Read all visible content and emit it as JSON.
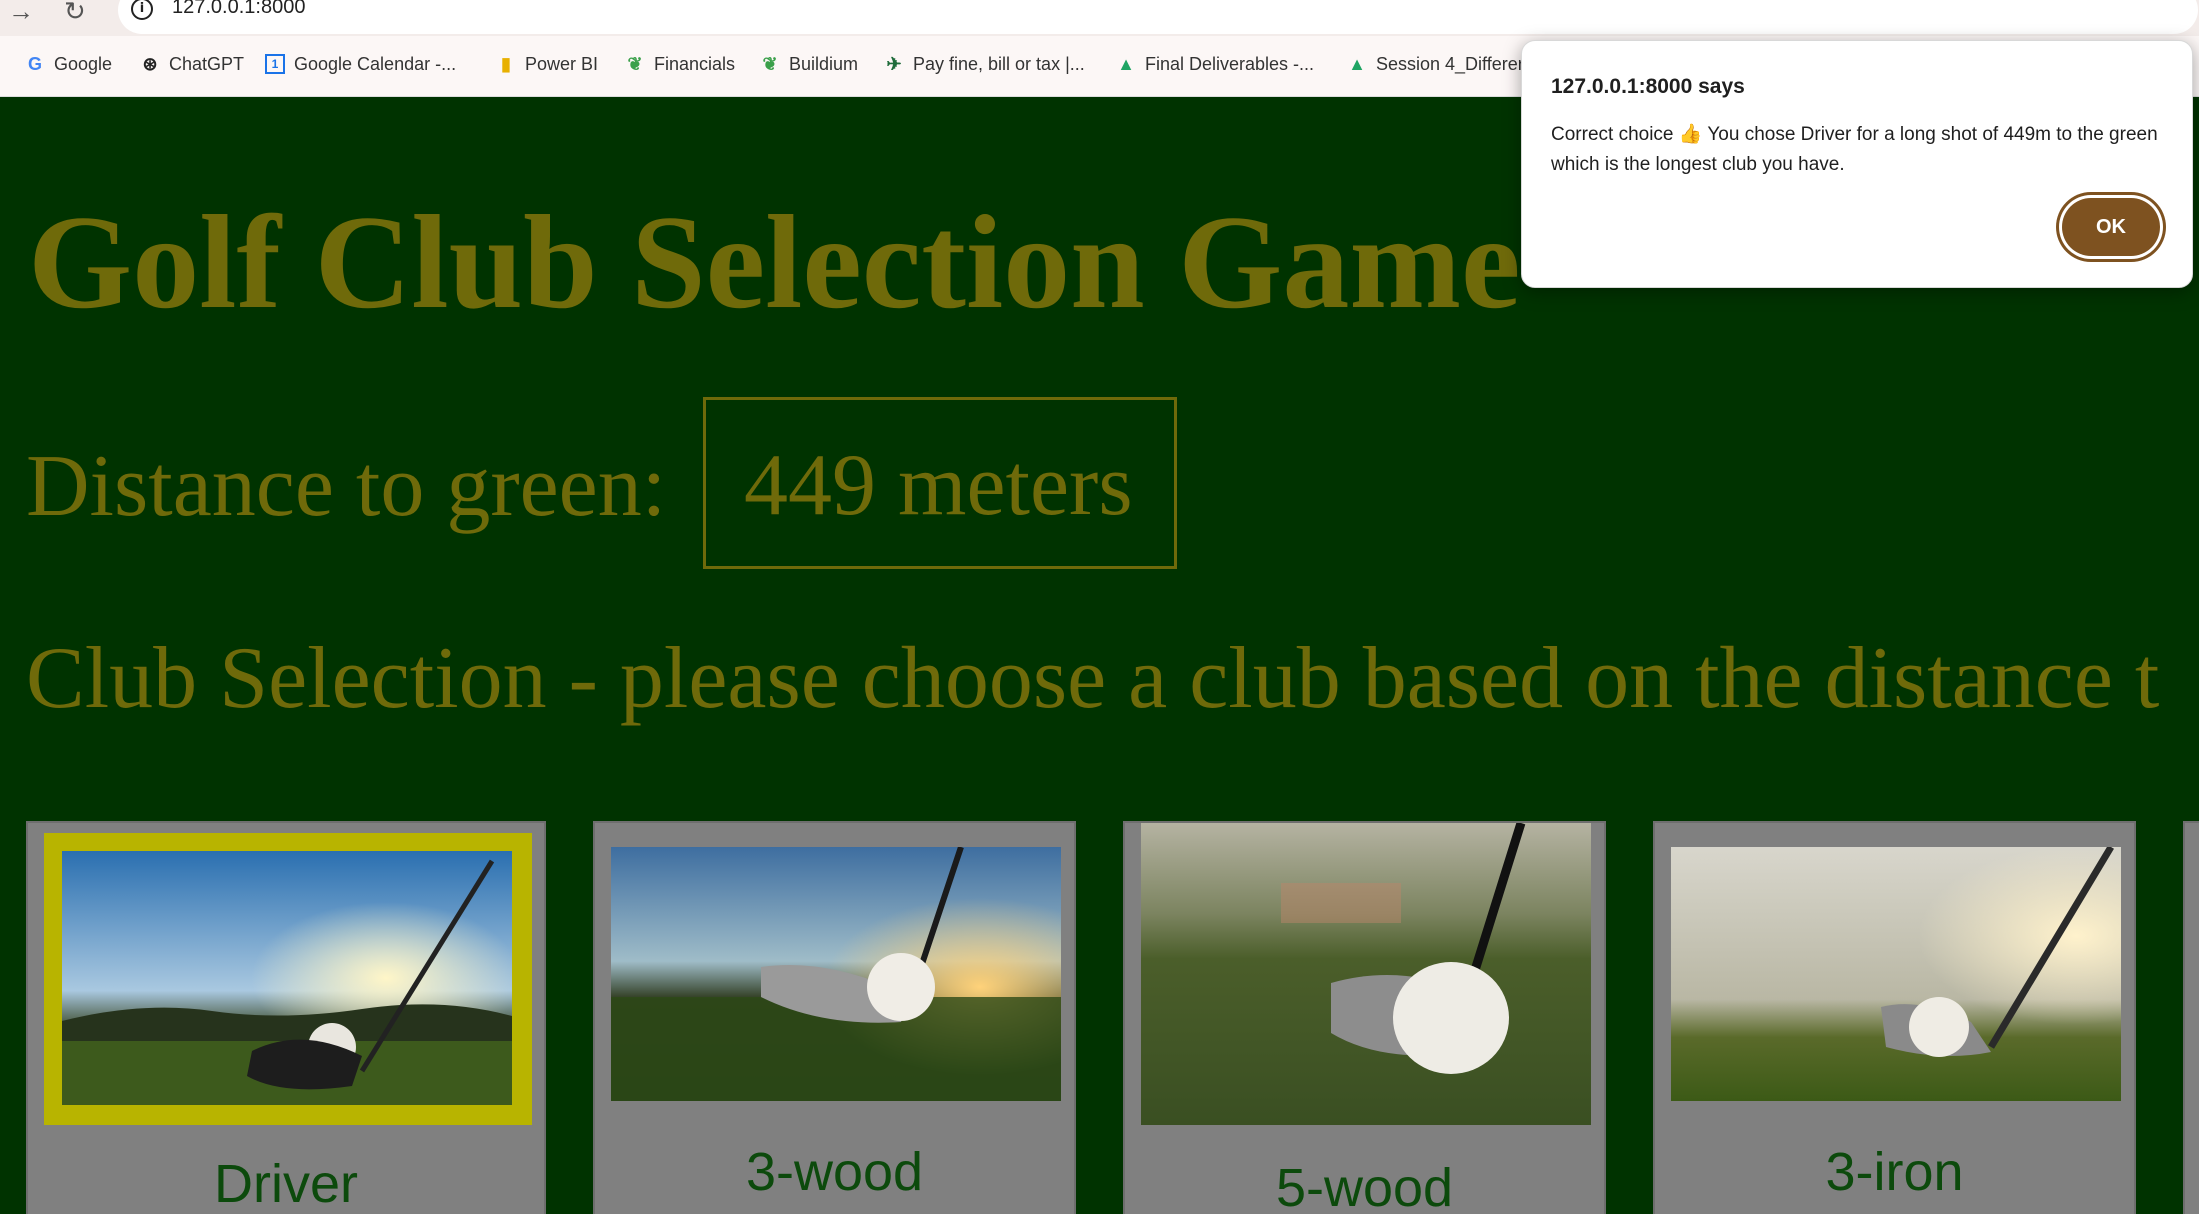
{
  "browser": {
    "url": "127.0.0.1:8000",
    "bookmarks": [
      {
        "label": "Google",
        "icon": "google-icon"
      },
      {
        "label": "ChatGPT",
        "icon": "chatgpt-icon"
      },
      {
        "label": "Google Calendar -...",
        "icon": "calendar-icon"
      },
      {
        "label": "Power BI",
        "icon": "powerbi-icon"
      },
      {
        "label": "Financials",
        "icon": "leaf-icon"
      },
      {
        "label": "Buildium",
        "icon": "leaf-icon"
      },
      {
        "label": "Pay fine, bill or tax |...",
        "icon": "bird-icon"
      },
      {
        "label": "Final Deliverables -...",
        "icon": "drive-icon"
      },
      {
        "label": "Session 4_Differer",
        "icon": "drive-icon"
      }
    ]
  },
  "game": {
    "title": "Golf Club Selection Game",
    "distance_label": "Distance to green:",
    "distance_value": "449 meters",
    "club_heading": "Club Selection - please choose a club based on the distance t",
    "clubs": [
      {
        "name": "Driver",
        "selected": true
      },
      {
        "name": "3-wood",
        "selected": false
      },
      {
        "name": "5-wood",
        "selected": false
      },
      {
        "name": "3-iron",
        "selected": false
      }
    ]
  },
  "dialog": {
    "title": "127.0.0.1:8000 says",
    "message": "Correct choice 👍 You chose Driver for a long shot of 449m to the green which is the longest club you have.",
    "ok_label": "OK"
  },
  "colors": {
    "page_bg": "#003300",
    "heading_text": "#6f6a0a",
    "card_bg": "#808080",
    "selected_frame": "#b8b400",
    "club_name": "#0c4a0c",
    "ok_button": "#7e5220"
  }
}
